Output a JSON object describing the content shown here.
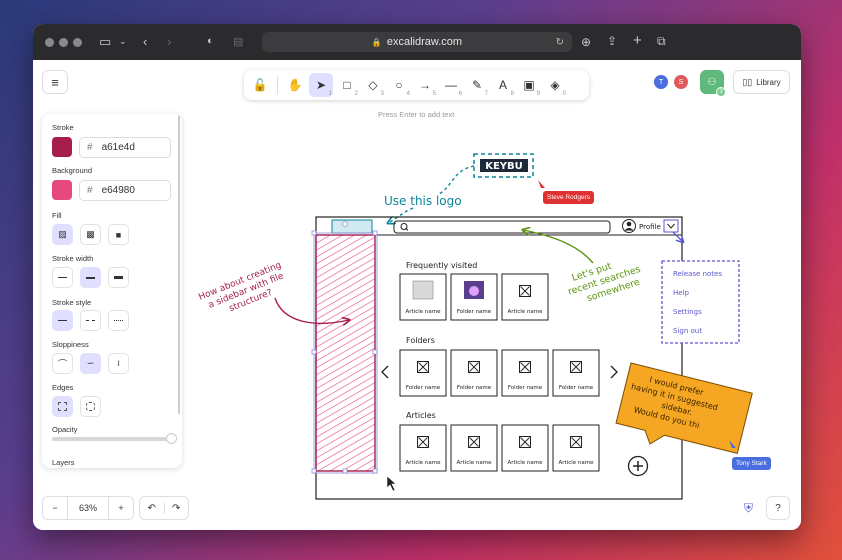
{
  "browser": {
    "url": "excalidraw.com"
  },
  "toolbar": {
    "hint": "Press Enter to add text",
    "tools": [
      {
        "name": "lock",
        "glyph": "🔓",
        "num": ""
      },
      {
        "name": "hand",
        "glyph": "✋",
        "num": ""
      },
      {
        "name": "selection",
        "glyph": "➤",
        "num": "1"
      },
      {
        "name": "rectangle",
        "glyph": "□",
        "num": "2"
      },
      {
        "name": "diamond",
        "glyph": "◇",
        "num": "3"
      },
      {
        "name": "ellipse",
        "glyph": "○",
        "num": "4"
      },
      {
        "name": "arrow",
        "glyph": "→",
        "num": "5"
      },
      {
        "name": "line",
        "glyph": "—",
        "num": "6"
      },
      {
        "name": "draw",
        "glyph": "✎",
        "num": "7"
      },
      {
        "name": "text",
        "glyph": "A",
        "num": "8"
      },
      {
        "name": "image",
        "glyph": "▣",
        "num": "9"
      },
      {
        "name": "eraser",
        "glyph": "◈",
        "num": "0"
      }
    ]
  },
  "collaborators": [
    {
      "initial": "T",
      "color": "#4a6ee0"
    },
    {
      "initial": "S",
      "color": "#e05a5a"
    }
  ],
  "share": {
    "count": "3"
  },
  "library": {
    "label": "Library"
  },
  "panel": {
    "stroke_label": "Stroke",
    "stroke_hex": "a61e4d",
    "stroke_color": "#a61e4d",
    "background_label": "Background",
    "background_hex": "e64980",
    "background_color": "#e64980",
    "fill_label": "Fill",
    "stroke_width_label": "Stroke width",
    "stroke_style_label": "Stroke style",
    "sloppiness_label": "Sloppiness",
    "edges_label": "Edges",
    "opacity_label": "Opacity",
    "layers_label": "Layers",
    "hash": "#",
    "opacity_value": 1.0
  },
  "zoom": {
    "minus": "−",
    "value": "63%",
    "plus": "+"
  },
  "undo": {
    "undo": "↶",
    "redo": "↷"
  },
  "help": {
    "label": "?"
  },
  "sketch": {
    "logo_note": "Use this logo",
    "logo_text": "KEYBU",
    "profile_label": "Profile",
    "sidebar_note": [
      "How about creating",
      "a sidebar with file",
      "structure?"
    ],
    "search_note": [
      "Let's put",
      "recent searches",
      "somewhere"
    ],
    "section_frequent": "Frequently visited",
    "section_folders": "Folders",
    "section_articles": "Articles",
    "frequent_cards": [
      "Article name",
      "Folder name",
      "Article name"
    ],
    "folder_cards": [
      "Folder name",
      "Folder name",
      "Folder name",
      "Folder name"
    ],
    "article_cards": [
      "Article name",
      "Article name",
      "Article name",
      "Article name"
    ],
    "menu_items": [
      "Release notes",
      "Help",
      "Settings",
      "Sign out"
    ],
    "sticky_note": [
      "I would prefer",
      "having it in suggested",
      "sidebar.",
      "Would do you thi"
    ],
    "cursor_tag_1": "Steve Rodgers",
    "cursor_tag_2": "Tony Stark"
  }
}
